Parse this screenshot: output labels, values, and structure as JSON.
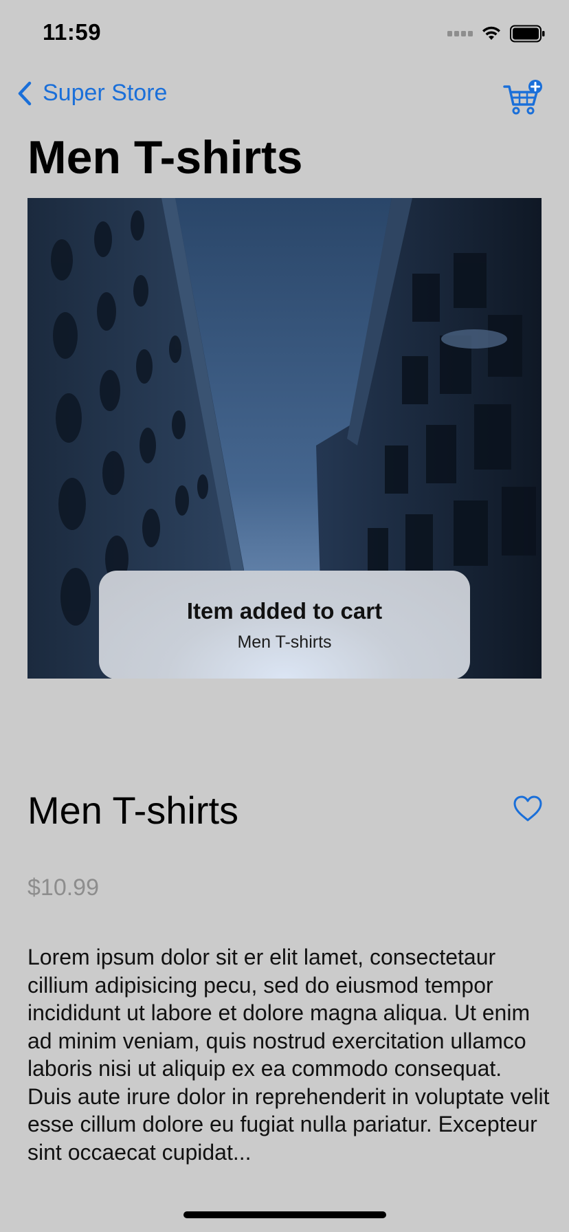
{
  "status": {
    "time": "11:59"
  },
  "nav": {
    "back_label": "Super Store"
  },
  "page": {
    "title": "Men T-shirts"
  },
  "toast": {
    "title": "Item added to cart",
    "subtitle": "Men T-shirts"
  },
  "product": {
    "name": "Men T-shirts",
    "price": "$10.99",
    "description": "Lorem ipsum dolor sit er elit lamet, consectetaur cillium adipisicing pecu, sed do eiusmod tempor incididunt ut labore et dolore magna aliqua. Ut enim ad minim veniam, quis nostrud exercitation ullamco laboris nisi ut aliquip ex ea commodo consequat. Duis aute irure dolor in reprehenderit in voluptate velit esse cillum dolore eu fugiat nulla pariatur. Excepteur sint occaecat cupidat..."
  },
  "icons": {
    "back": "chevron-left-icon",
    "cart": "cart-plus-icon",
    "favorite": "heart-outline-icon",
    "signal": "cellular-signal-icon",
    "wifi": "wifi-icon",
    "battery": "battery-icon"
  },
  "colors": {
    "accent": "#1a6fd9",
    "background": "#cbcbcb",
    "price": "#8d8d8d"
  }
}
